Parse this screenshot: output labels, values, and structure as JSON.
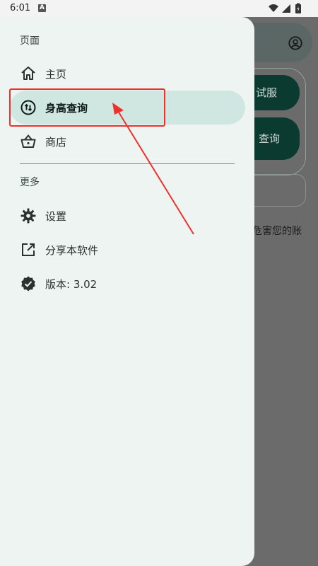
{
  "status_bar": {
    "time": "6:01",
    "notification_glyph": "A",
    "icons": [
      "wifi-icon",
      "signal-icon",
      "battery-icon"
    ]
  },
  "background_app": {
    "button_1_label": "试服",
    "button_2_label": "查询",
    "warning_text": "危害您的账"
  },
  "drawer": {
    "pages_section_label": "页面",
    "items": [
      {
        "label": "主页",
        "icon": "home-icon",
        "active": false
      },
      {
        "label": "身高查询",
        "icon": "swap-vertical-icon",
        "active": true
      },
      {
        "label": "商店",
        "icon": "basket-icon",
        "active": false
      }
    ],
    "more_section_label": "更多",
    "more_items": [
      {
        "label": "设置",
        "icon": "gear-icon"
      },
      {
        "label": "分享本软件",
        "icon": "open-in-new-icon"
      },
      {
        "label": "版本: 3.02",
        "icon": "verified-badge-icon"
      }
    ]
  },
  "colors": {
    "drawer_bg": "#eef4f2",
    "active_item_bg": "#cfe7e0",
    "scrim": "#6b6b6b",
    "annotation_red": "#f0302a",
    "primary_dark": "#0b3a30"
  }
}
